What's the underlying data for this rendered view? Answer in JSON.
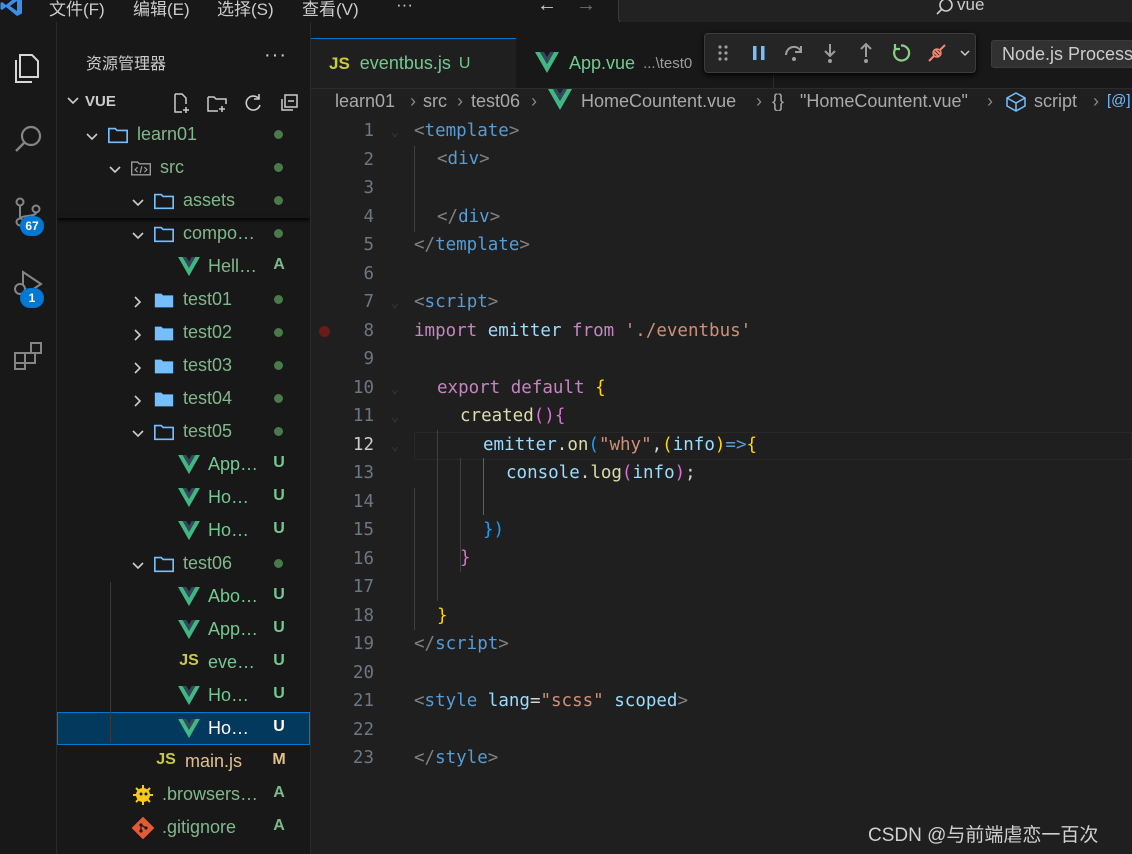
{
  "titlebar": {
    "menus": [
      "文件(F)",
      "编辑(E)",
      "选择(S)",
      "查看(V)",
      "···"
    ],
    "search_text": "vue"
  },
  "activity_bar": {
    "items": [
      {
        "name": "explorer-icon"
      },
      {
        "name": "search-icon"
      },
      {
        "name": "source-control-icon",
        "badge": "67"
      },
      {
        "name": "run-debug-icon",
        "badge": "1"
      },
      {
        "name": "extensions-icon"
      }
    ]
  },
  "sidebar": {
    "title": "资源管理器",
    "more": "···",
    "section": "VUE",
    "tree": [
      {
        "name": "learn01",
        "type": "folder-open",
        "depth": 0,
        "status": "dot"
      },
      {
        "name": "src",
        "type": "src-folder",
        "depth": 1,
        "status": "dot"
      },
      {
        "name": "assets",
        "type": "folder-open",
        "depth": 2,
        "status": "dot"
      },
      {
        "name": "compone...",
        "type": "folder-open",
        "depth": 2,
        "status": "dot"
      },
      {
        "name": "HelloWo...",
        "type": "vue",
        "depth": 3,
        "status": "A"
      },
      {
        "name": "test01",
        "type": "folder",
        "depth": 2,
        "status": "dot"
      },
      {
        "name": "test02",
        "type": "folder",
        "depth": 2,
        "status": "dot"
      },
      {
        "name": "test03",
        "type": "folder",
        "depth": 2,
        "status": "dot"
      },
      {
        "name": "test04",
        "type": "folder",
        "depth": 2,
        "status": "dot"
      },
      {
        "name": "test05",
        "type": "folder-open",
        "depth": 2,
        "status": "dot"
      },
      {
        "name": "App.vue",
        "type": "vue",
        "depth": 3,
        "status": "U"
      },
      {
        "name": "Home.vue",
        "type": "vue",
        "depth": 3,
        "status": "U"
      },
      {
        "name": "HomeC...",
        "type": "vue",
        "depth": 3,
        "status": "U"
      },
      {
        "name": "test06",
        "type": "folder-open",
        "depth": 2,
        "status": "dot"
      },
      {
        "name": "About.vue",
        "type": "vue",
        "depth": 3,
        "status": "U"
      },
      {
        "name": "App.vue",
        "type": "vue",
        "depth": 3,
        "status": "U"
      },
      {
        "name": "eventbu...",
        "type": "js",
        "depth": 3,
        "status": "U"
      },
      {
        "name": "Home.vue",
        "type": "vue",
        "depth": 3,
        "status": "U"
      },
      {
        "name": "HomeC...",
        "type": "vue",
        "depth": 3,
        "status": "U",
        "selected": true
      },
      {
        "name": "main.js",
        "type": "js",
        "depth": 2,
        "status": "M"
      },
      {
        "name": ".browserslis...",
        "type": "browserslist",
        "depth": 1,
        "status": "A"
      },
      {
        "name": ".gitignore",
        "type": "git",
        "depth": 1,
        "status": "A"
      }
    ]
  },
  "tabs": [
    {
      "icon": "JS",
      "label": "eventbus.js",
      "status": "U",
      "active": true
    },
    {
      "icon": "vue",
      "label": "App.vue",
      "desc": "...\\test0",
      "active": false
    }
  ],
  "debug_toolbar": {
    "process": "Node.js Process"
  },
  "breadcrumb": {
    "items": [
      "learn01",
      "src",
      "test06",
      "HomeCountent.vue",
      "\"HomeCountent.vue\"",
      "script"
    ],
    "icons": [
      "{}",
      "script-icon",
      "[@]"
    ]
  },
  "editor": {
    "current_line": 12,
    "breakpoint_line": 8,
    "line_numbers": [
      "1",
      "2",
      "3",
      "4",
      "5",
      "6",
      "7",
      "8",
      "9",
      "10",
      "11",
      "12",
      "13",
      "14",
      "15",
      "16",
      "17",
      "18",
      "19",
      "20",
      "21",
      "22",
      "23"
    ]
  },
  "code_tokens": {
    "l1": [
      "<",
      "template",
      ">"
    ],
    "l2": [
      "<",
      "div",
      ">"
    ],
    "l4": [
      "</",
      "div",
      ">"
    ],
    "l5": [
      "</",
      "template",
      ">"
    ],
    "l7": [
      "<",
      "script",
      ">"
    ],
    "l8": [
      "import",
      " emitter ",
      "from",
      " ",
      "'./eventbus'"
    ],
    "l10": [
      "export",
      " ",
      "default",
      " ",
      "{"
    ],
    "l11": [
      "created",
      "()",
      "{"
    ],
    "l12": [
      "emitter",
      ".",
      "on",
      "(",
      "\"why\"",
      ",",
      "(",
      "info",
      ")",
      "=>",
      "{"
    ],
    "l13": [
      "console",
      ".",
      "log",
      "(",
      "info",
      ")",
      ";"
    ],
    "l15": [
      "})"
    ],
    "l16": [
      "}"
    ],
    "l18": [
      "}"
    ],
    "l19": [
      "</",
      "script",
      ">"
    ],
    "l21": [
      "<",
      "style",
      " ",
      "lang",
      "=",
      "\"scss\"",
      " ",
      "scoped",
      ">"
    ],
    "l23": [
      "</",
      "style",
      ">"
    ]
  },
  "watermark": "CSDN @与前端虐恋一百次",
  "colors": {
    "accent": "#0078d4",
    "untracked": "#73c991",
    "modified": "#e2c08d",
    "added": "#81b88b",
    "vue_icon": "#41b883",
    "js_icon": "#cbcb41"
  }
}
